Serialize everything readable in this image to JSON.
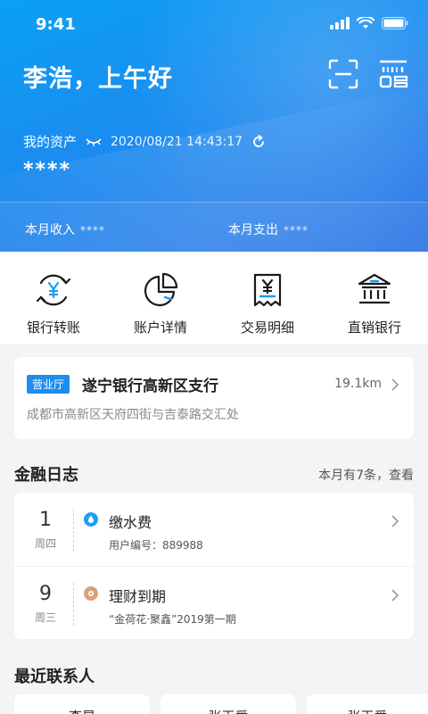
{
  "status": {
    "time": "9:41"
  },
  "header": {
    "greeting": "李浩，上午好"
  },
  "assets": {
    "label": "我的资产",
    "date": "2020/08/21 14:43:17",
    "value": "****"
  },
  "monthly": {
    "income_label": "本月收入",
    "income_value": "****",
    "expense_label": "本月支出",
    "expense_value": "****"
  },
  "quick_actions": [
    {
      "label": "银行转账",
      "icon": "transfer-yuan-icon"
    },
    {
      "label": "账户详情",
      "icon": "pie-chart-icon"
    },
    {
      "label": "交易明细",
      "icon": "receipt-icon"
    },
    {
      "label": "直销银行",
      "icon": "bank-icon"
    }
  ],
  "branch": {
    "badge": "营业厅",
    "name": "遂宁银行高新区支行",
    "distance": "19.1km",
    "address": "成都市高新区天府四街与吉泰路交汇处"
  },
  "finance_log": {
    "title": "金融日志",
    "summary": "本月有7条，查看",
    "items": [
      {
        "day": "1",
        "weekday": "周四",
        "title": "缴水费",
        "detail": "用户编号：889988",
        "icon": "water-drop-icon",
        "color": "#1ea0f2"
      },
      {
        "day": "9",
        "weekday": "周三",
        "title": "理财到期",
        "detail": "“金荷花·聚鑫”2019第一期",
        "icon": "wealth-icon",
        "color": "#d9a27a"
      }
    ]
  },
  "contacts": {
    "title": "最近联系人",
    "items": [
      {
        "name": "李昂"
      },
      {
        "name": "张玉爱"
      },
      {
        "name": "张玉爱"
      }
    ]
  },
  "colors": {
    "primary": "#1f8df0",
    "hero_start": "#0aa0f5",
    "hero_end": "#2f73e6"
  }
}
